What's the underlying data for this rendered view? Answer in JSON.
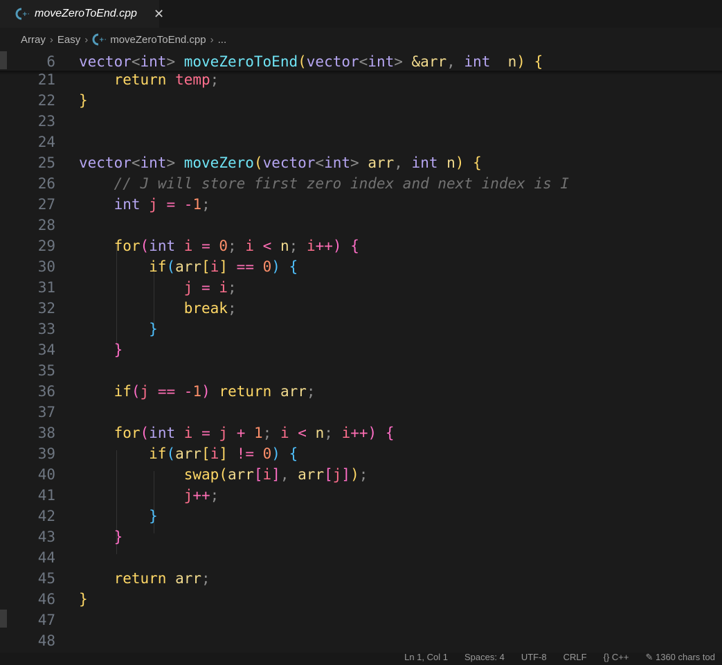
{
  "tab": {
    "title": "moveZeroToEnd.cpp",
    "close": "✕"
  },
  "breadcrumb": {
    "items": [
      "Array",
      "Easy",
      "moveZeroToEnd.cpp",
      "..."
    ],
    "separator": "›"
  },
  "editor": {
    "lines": [
      {
        "num": "6",
        "tokens": [
          [
            "t-type",
            "vector"
          ],
          [
            "t-punc",
            "<"
          ],
          [
            "t-type",
            "int"
          ],
          [
            "t-punc",
            "> "
          ],
          [
            "t-fn",
            "moveZeroToEnd"
          ],
          [
            "t-p1",
            "("
          ],
          [
            "t-type",
            "vector"
          ],
          [
            "t-punc",
            "<"
          ],
          [
            "t-type",
            "int"
          ],
          [
            "t-punc",
            "> "
          ],
          [
            "t-amp",
            "&arr"
          ],
          [
            "t-punc",
            ", "
          ],
          [
            "t-type",
            "int"
          ],
          [
            "",
            "  "
          ],
          [
            "t-var",
            "n"
          ],
          [
            "t-p1",
            ")"
          ],
          [
            "",
            " "
          ],
          [
            "t-p1",
            "{"
          ]
        ]
      },
      {
        "num": "21",
        "tokens": [
          [
            "",
            "    "
          ],
          [
            "t-kw",
            "return"
          ],
          [
            "",
            " "
          ],
          [
            "t-id",
            "temp"
          ],
          [
            "t-punc",
            ";"
          ]
        ]
      },
      {
        "num": "22",
        "tokens": [
          [
            "t-p1",
            "}"
          ]
        ]
      },
      {
        "num": "23",
        "tokens": []
      },
      {
        "num": "24",
        "tokens": []
      },
      {
        "num": "25",
        "tokens": [
          [
            "t-type",
            "vector"
          ],
          [
            "t-punc",
            "<"
          ],
          [
            "t-type",
            "int"
          ],
          [
            "t-punc",
            "> "
          ],
          [
            "t-fn",
            "moveZero"
          ],
          [
            "t-p1",
            "("
          ],
          [
            "t-type",
            "vector"
          ],
          [
            "t-punc",
            "<"
          ],
          [
            "t-type",
            "int"
          ],
          [
            "t-punc",
            "> "
          ],
          [
            "t-var",
            "arr"
          ],
          [
            "t-punc",
            ", "
          ],
          [
            "t-type",
            "int"
          ],
          [
            "",
            " "
          ],
          [
            "t-var",
            "n"
          ],
          [
            "t-p1",
            ")"
          ],
          [
            "",
            " "
          ],
          [
            "t-p1",
            "{"
          ]
        ]
      },
      {
        "num": "26",
        "tokens": [
          [
            "",
            "    "
          ],
          [
            "t-cm",
            "// J will store first zero index and next index is I"
          ]
        ]
      },
      {
        "num": "27",
        "tokens": [
          [
            "",
            "    "
          ],
          [
            "t-type",
            "int"
          ],
          [
            "",
            " "
          ],
          [
            "t-id",
            "j"
          ],
          [
            "",
            " "
          ],
          [
            "t-op",
            "="
          ],
          [
            "",
            " "
          ],
          [
            "t-op",
            "-"
          ],
          [
            "t-num",
            "1"
          ],
          [
            "t-punc",
            ";"
          ]
        ]
      },
      {
        "num": "28",
        "tokens": []
      },
      {
        "num": "29",
        "tokens": [
          [
            "",
            "    "
          ],
          [
            "t-kw",
            "for"
          ],
          [
            "t-p2",
            "("
          ],
          [
            "t-type",
            "int"
          ],
          [
            "",
            " "
          ],
          [
            "t-id",
            "i"
          ],
          [
            "",
            " "
          ],
          [
            "t-op",
            "="
          ],
          [
            "",
            " "
          ],
          [
            "t-num",
            "0"
          ],
          [
            "t-punc",
            ";"
          ],
          [
            "",
            " "
          ],
          [
            "t-id",
            "i"
          ],
          [
            "",
            " "
          ],
          [
            "t-op",
            "<"
          ],
          [
            "",
            " "
          ],
          [
            "t-var",
            "n"
          ],
          [
            "t-punc",
            ";"
          ],
          [
            "",
            " "
          ],
          [
            "t-id",
            "i"
          ],
          [
            "t-op",
            "++"
          ],
          [
            "t-p2",
            ")"
          ],
          [
            "",
            " "
          ],
          [
            "t-p2",
            "{"
          ]
        ]
      },
      {
        "num": "30",
        "tokens": [
          [
            "",
            "        "
          ],
          [
            "t-kw",
            "if"
          ],
          [
            "t-p3",
            "("
          ],
          [
            "t-var",
            "arr"
          ],
          [
            "t-p1",
            "["
          ],
          [
            "t-id",
            "i"
          ],
          [
            "t-p1",
            "]"
          ],
          [
            "",
            " "
          ],
          [
            "t-op",
            "=="
          ],
          [
            "",
            " "
          ],
          [
            "t-num",
            "0"
          ],
          [
            "t-p3",
            ")"
          ],
          [
            "",
            " "
          ],
          [
            "t-p3",
            "{"
          ]
        ]
      },
      {
        "num": "31",
        "tokens": [
          [
            "",
            "            "
          ],
          [
            "t-id",
            "j"
          ],
          [
            "",
            " "
          ],
          [
            "t-op",
            "="
          ],
          [
            "",
            " "
          ],
          [
            "t-id",
            "i"
          ],
          [
            "t-punc",
            ";"
          ]
        ]
      },
      {
        "num": "32",
        "tokens": [
          [
            "",
            "            "
          ],
          [
            "t-kw",
            "break"
          ],
          [
            "t-punc",
            ";"
          ]
        ]
      },
      {
        "num": "33",
        "tokens": [
          [
            "",
            "        "
          ],
          [
            "t-p3",
            "}"
          ]
        ]
      },
      {
        "num": "34",
        "tokens": [
          [
            "",
            "    "
          ],
          [
            "t-p2",
            "}"
          ]
        ]
      },
      {
        "num": "35",
        "tokens": []
      },
      {
        "num": "36",
        "tokens": [
          [
            "",
            "    "
          ],
          [
            "t-kw",
            "if"
          ],
          [
            "t-p2",
            "("
          ],
          [
            "t-id",
            "j"
          ],
          [
            "",
            " "
          ],
          [
            "t-op",
            "=="
          ],
          [
            "",
            " "
          ],
          [
            "t-op",
            "-"
          ],
          [
            "t-num",
            "1"
          ],
          [
            "t-p2",
            ")"
          ],
          [
            "",
            " "
          ],
          [
            "t-kw",
            "return"
          ],
          [
            "",
            " "
          ],
          [
            "t-var",
            "arr"
          ],
          [
            "t-punc",
            ";"
          ]
        ]
      },
      {
        "num": "37",
        "tokens": []
      },
      {
        "num": "38",
        "tokens": [
          [
            "",
            "    "
          ],
          [
            "t-kw",
            "for"
          ],
          [
            "t-p2",
            "("
          ],
          [
            "t-type",
            "int"
          ],
          [
            "",
            " "
          ],
          [
            "t-id",
            "i"
          ],
          [
            "",
            " "
          ],
          [
            "t-op",
            "="
          ],
          [
            "",
            " "
          ],
          [
            "t-id",
            "j"
          ],
          [
            "",
            " "
          ],
          [
            "t-op",
            "+"
          ],
          [
            "",
            " "
          ],
          [
            "t-num",
            "1"
          ],
          [
            "t-punc",
            ";"
          ],
          [
            "",
            " "
          ],
          [
            "t-id",
            "i"
          ],
          [
            "",
            " "
          ],
          [
            "t-op",
            "<"
          ],
          [
            "",
            " "
          ],
          [
            "t-var",
            "n"
          ],
          [
            "t-punc",
            ";"
          ],
          [
            "",
            " "
          ],
          [
            "t-id",
            "i"
          ],
          [
            "t-op",
            "++"
          ],
          [
            "t-p2",
            ")"
          ],
          [
            "",
            " "
          ],
          [
            "t-p2",
            "{"
          ]
        ]
      },
      {
        "num": "39",
        "tokens": [
          [
            "",
            "        "
          ],
          [
            "t-kw",
            "if"
          ],
          [
            "t-p3",
            "("
          ],
          [
            "t-var",
            "arr"
          ],
          [
            "t-p1",
            "["
          ],
          [
            "t-id",
            "i"
          ],
          [
            "t-p1",
            "]"
          ],
          [
            "",
            " "
          ],
          [
            "t-op",
            "!="
          ],
          [
            "",
            " "
          ],
          [
            "t-num",
            "0"
          ],
          [
            "t-p3",
            ")"
          ],
          [
            "",
            " "
          ],
          [
            "t-p3",
            "{"
          ]
        ]
      },
      {
        "num": "40",
        "tokens": [
          [
            "",
            "            "
          ],
          [
            "t-kw",
            "swap"
          ],
          [
            "t-p1",
            "("
          ],
          [
            "t-var",
            "arr"
          ],
          [
            "t-p2",
            "["
          ],
          [
            "t-id",
            "i"
          ],
          [
            "t-p2",
            "]"
          ],
          [
            "t-punc",
            ", "
          ],
          [
            "t-var",
            "arr"
          ],
          [
            "t-p2",
            "["
          ],
          [
            "t-id",
            "j"
          ],
          [
            "t-p2",
            "]"
          ],
          [
            "t-p1",
            ")"
          ],
          [
            "t-punc",
            ";"
          ]
        ]
      },
      {
        "num": "41",
        "tokens": [
          [
            "",
            "            "
          ],
          [
            "t-id",
            "j"
          ],
          [
            "t-op",
            "++"
          ],
          [
            "t-punc",
            ";"
          ]
        ]
      },
      {
        "num": "42",
        "tokens": [
          [
            "",
            "        "
          ],
          [
            "t-p3",
            "}"
          ]
        ]
      },
      {
        "num": "43",
        "tokens": [
          [
            "",
            "    "
          ],
          [
            "t-p2",
            "}"
          ]
        ]
      },
      {
        "num": "44",
        "tokens": []
      },
      {
        "num": "45",
        "tokens": [
          [
            "",
            "    "
          ],
          [
            "t-kw",
            "return"
          ],
          [
            "",
            " "
          ],
          [
            "t-var",
            "arr"
          ],
          [
            "t-punc",
            ";"
          ]
        ]
      },
      {
        "num": "46",
        "tokens": [
          [
            "t-p1",
            "}"
          ]
        ]
      },
      {
        "num": "47",
        "tokens": []
      },
      {
        "num": "48",
        "tokens": []
      }
    ]
  },
  "status": {
    "position": "Ln 1, Col 1",
    "spaces": "Spaces: 4",
    "encoding": "UTF-8",
    "eol": "CRLF",
    "language": "{} C++",
    "chars": "✎ 1360 chars tod"
  },
  "colors": {
    "background": "#1b1b1b",
    "keyword": "#ffd866",
    "function": "#6fe3f4",
    "type": "#b6a6f2",
    "number": "#fd8f6a",
    "identifier": "#ff6f8e",
    "comment": "#727272"
  }
}
